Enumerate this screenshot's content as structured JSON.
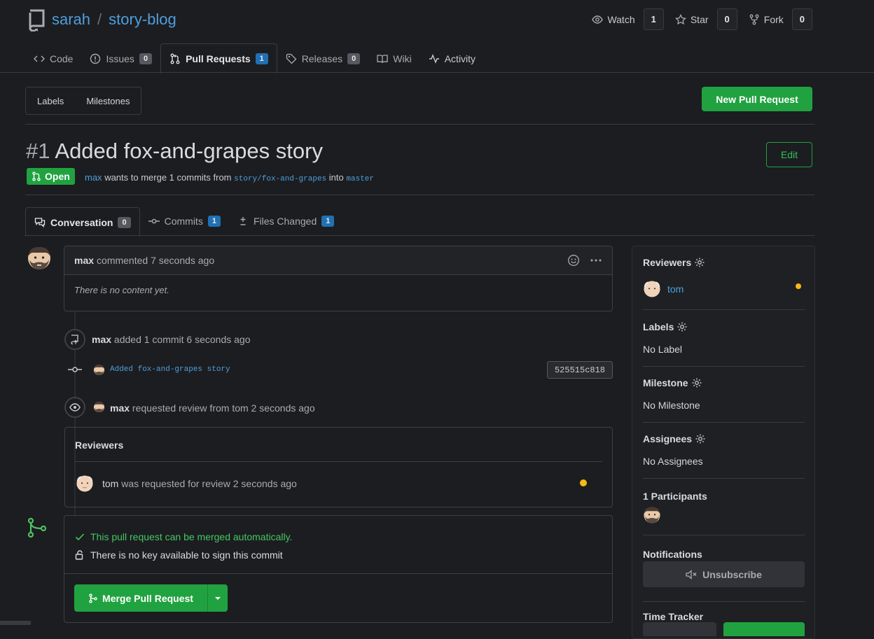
{
  "repo": {
    "owner": "sarah",
    "separator": "/",
    "name": "story-blog"
  },
  "repo_actions": [
    {
      "label": "Watch",
      "count": "1"
    },
    {
      "label": "Star",
      "count": "0"
    },
    {
      "label": "Fork",
      "count": "0"
    }
  ],
  "nav": {
    "code": "Code",
    "issues": {
      "label": "Issues",
      "count": "0"
    },
    "pulls": {
      "label": "Pull Requests",
      "count": "1"
    },
    "releases": {
      "label": "Releases",
      "count": "0"
    },
    "wiki": "Wiki",
    "activity": "Activity"
  },
  "subnav": {
    "labels": "Labels",
    "milestones": "Milestones",
    "new_pr": "New Pull Request"
  },
  "pr": {
    "number": "#1",
    "title": "Added fox-and-grapes story",
    "edit": "Edit",
    "state": "Open",
    "author": "max",
    "desc_mid": "wants to merge 1 commits from",
    "head": "story/fox-and-grapes",
    "into": "into",
    "base": "master"
  },
  "tabs": {
    "conversation": {
      "label": "Conversation",
      "count": "0"
    },
    "commits": {
      "label": "Commits",
      "count": "1"
    },
    "files": {
      "label": "Files Changed",
      "count": "1"
    }
  },
  "comment": {
    "author": "max",
    "action": "commented 7 seconds ago",
    "body": "There is no content yet."
  },
  "events": {
    "commit_added": {
      "author": "max",
      "text": "added 1 commit 6 seconds ago"
    },
    "commit": {
      "message": "Added fox-and-grapes story",
      "sha": "525515c818"
    },
    "review_requested": {
      "author": "max",
      "text": "requested review from tom 2 seconds ago"
    }
  },
  "reviewers_box": {
    "title": "Reviewers",
    "user": "tom",
    "text": "was requested for review 2 seconds ago"
  },
  "merge": {
    "ok": "This pull request can be merged automatically.",
    "key": "There is no key available to sign this commit",
    "button": "Merge Pull Request"
  },
  "sidebar": {
    "reviewers": {
      "title": "Reviewers",
      "user": "tom"
    },
    "labels": {
      "title": "Labels",
      "value": "No Label"
    },
    "milestone": {
      "title": "Milestone",
      "value": "No Milestone"
    },
    "assignees": {
      "title": "Assignees",
      "value": "No Assignees"
    },
    "participants": {
      "title": "1 Participants"
    },
    "notifications": {
      "title": "Notifications",
      "button": "Unsubscribe"
    },
    "time_tracker": {
      "title": "Time Tracker"
    }
  },
  "colors": {
    "accent_green": "#21a240",
    "link_blue": "#4e9fdc",
    "pending_dot": "#f7b918",
    "background": "#1c1d20"
  }
}
